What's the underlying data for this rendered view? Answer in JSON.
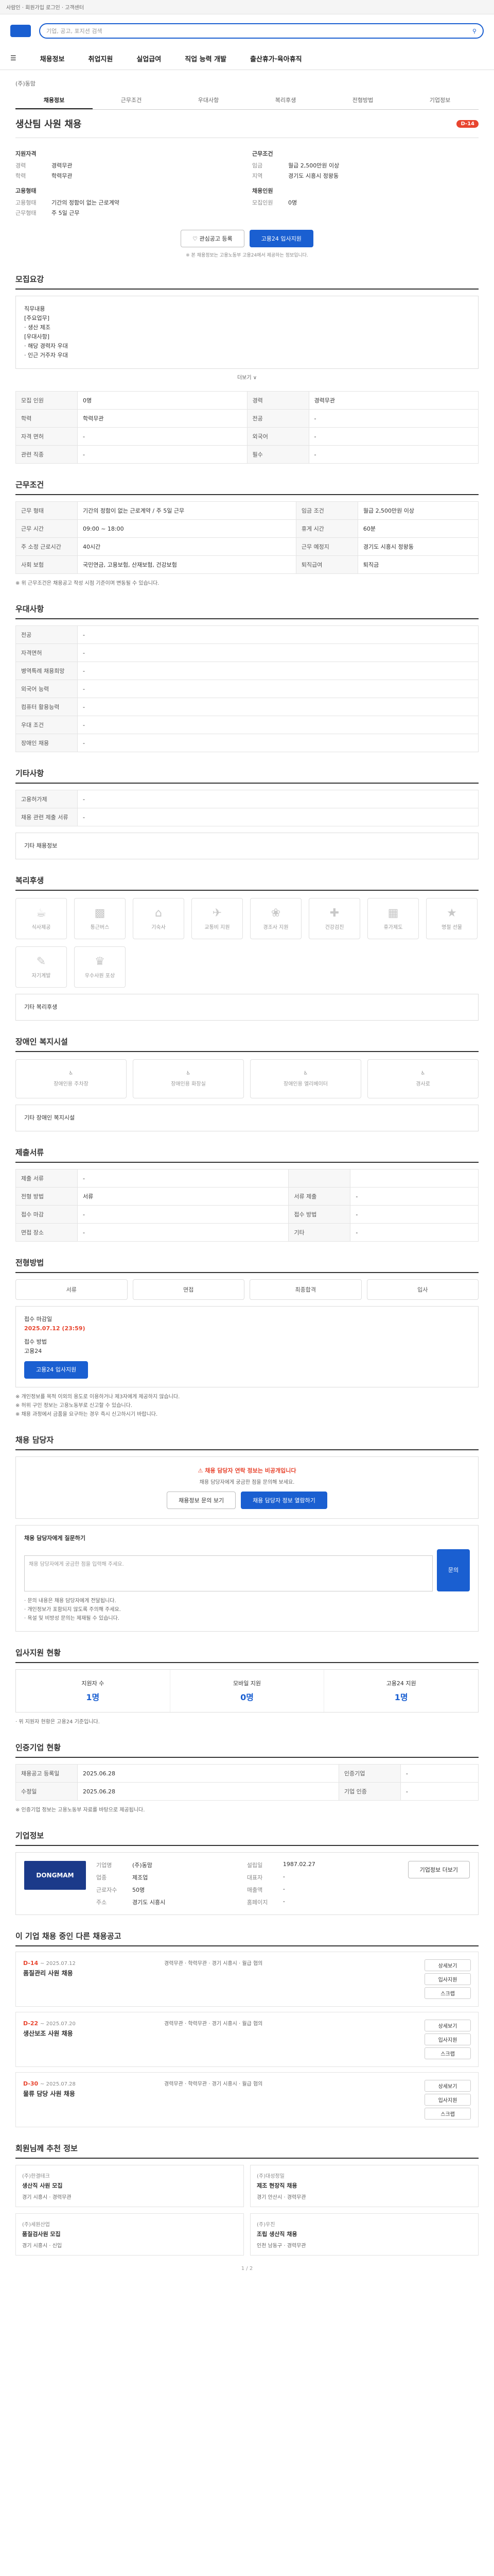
{
  "topbar": {
    "text": "사람인 · 회원가입 로그인 · 고객센터"
  },
  "search": {
    "placeholder": "기업, 공고, 포지션 검색"
  },
  "gnb": [
    "채용정보",
    "취업지원",
    "실업급여",
    "직업 능력 개발",
    "출산휴가·육아휴직"
  ],
  "company_line": "(주)동맘",
  "tabs": [
    "채용정보",
    "근무조건",
    "우대사항",
    "복리후생",
    "전형방법",
    "기업정보"
  ],
  "job": {
    "title": "생산팀 사원 채용",
    "dday": "D-14"
  },
  "summary_left": {
    "h1": "지원자격",
    "rows1": [
      [
        "경력",
        "경력무관"
      ],
      [
        "학력",
        "학력무관"
      ]
    ],
    "h2": "고용형태",
    "rows2": [
      [
        "고용형태",
        "기간의 정함이 없는 근로계약"
      ],
      [
        "근무형태",
        "주 5일 근무"
      ]
    ]
  },
  "summary_right": {
    "h1": "근무조건",
    "rows1": [
      [
        "임금",
        "월급 2,500만원 이상"
      ],
      [
        "지역",
        "경기도 시흥시 정왕동"
      ]
    ],
    "h2": "채용인원",
    "rows2": [
      [
        "모집인원",
        "0명"
      ]
    ]
  },
  "buttons": {
    "scrap": "관심공고 등록",
    "apply": "고용24 입사지원"
  },
  "notice": "※ 본 채용정보는 고용노동부 고용24에서 제공하는 정보입니다.",
  "sections": {
    "s1": "모집요강",
    "s2": "근무조건",
    "s3": "우대사항",
    "s4": "기타사항",
    "s5": "복리후생",
    "s6": "장애인 복지시설",
    "s7": "제출서류",
    "s8": "전형방법",
    "s9": "채용 담당자",
    "s10": "입사지원 현황",
    "s11": "인증기업 현황",
    "s12": "기업정보",
    "s13": "이 기업 채용 중인 다른 채용공고",
    "s14": "회원님께 추천 정보"
  },
  "duty": {
    "lines": [
      "직무내용",
      "[주요업무]",
      "· 생산 제조",
      "[우대사항]",
      "· 해당 경력자 우대",
      "· 인근 거주자 우대"
    ],
    "more": "더보기 ∨"
  },
  "recruit_table": [
    [
      "모집 인원",
      "0명",
      "경력",
      "경력무관"
    ],
    [
      "학력",
      "학력무관",
      "전공",
      "-"
    ],
    [
      "자격 면허",
      "-",
      "외국어",
      "-"
    ],
    [
      "관련 직종",
      "-",
      "필수",
      "-"
    ]
  ],
  "work_table": [
    [
      "근무 형태",
      "기간의 정함이 없는 근로계약 / 주 5일 근무",
      "임금 조건",
      "월급 2,500만원 이상"
    ],
    [
      "근무 시간",
      "09:00 ~ 18:00",
      "휴게 시간",
      "60분"
    ],
    [
      "주 소정 근로시간",
      "40시간",
      "근무 예정지",
      "경기도 시흥시 정왕동"
    ],
    [
      "사회 보험",
      "국민연금, 고용보험, 산재보험, 건강보험",
      "퇴직급여",
      "퇴직금"
    ]
  ],
  "work_note": "※ 위 근무조건은 채용공고 작성 시점 기준이며 변동될 수 있습니다.",
  "pref_table": [
    [
      "전공",
      "-"
    ],
    [
      "자격면허",
      "-"
    ],
    [
      "병역특례 채용희망",
      "-"
    ],
    [
      "외국어 능력",
      "-"
    ],
    [
      "컴퓨터 활용능력",
      "-"
    ],
    [
      "우대 조건",
      "-"
    ],
    [
      "장애인 채용",
      "-"
    ]
  ],
  "etc_table": [
    [
      "고용허가제",
      "-"
    ],
    [
      "채용 관련 제출 서류",
      "-"
    ]
  ],
  "etc_more": "기타 채용정보",
  "welfare_items": [
    "식사제공",
    "통근버스",
    "기숙사",
    "교통비 지원",
    "경조사 지원",
    "건강검진",
    "휴가제도",
    "명절 선물",
    "자기계발",
    "우수사원 포상"
  ],
  "welfare_note": "기타 복리후생",
  "disability_items": [
    "장애인용 주차장",
    "장애인용 화장실",
    "장애인용 엘리베이터",
    "경사로"
  ],
  "disability_note": "기타 장애인 복지시설",
  "docs_table": [
    [
      "제출 서류",
      "-",
      "",
      ""
    ],
    [
      "전형 방법",
      "서류",
      "서류 제출",
      "-"
    ],
    [
      "접수 마감",
      "-",
      "접수 방법",
      "-"
    ],
    [
      "면접 장소",
      "-",
      "기타",
      "-"
    ]
  ],
  "process": [
    "서류",
    "면접",
    "최종합격",
    "입사"
  ],
  "apply": {
    "h": "접수 마감일",
    "date": "2025.07.12 (23:59)",
    "method_h": "접수 방법",
    "method": "고용24",
    "button": "고용24 입사지원"
  },
  "apply_notes": [
    "※ 개인정보를 목적 이외의 용도로 이용하거나 제3자에게 제공하지 않습니다.",
    "※ 허위 구인 정보는 고용노동부로 신고할 수 있습니다.",
    "※ 채용 과정에서 금품을 요구하는 경우 즉시 신고하시기 바랍니다."
  ],
  "qa": {
    "alert": "채용 담당자 연락 정보는 비공개입니다",
    "sub": "채용 담당자에게 궁금한 점을 문의해 보세요.",
    "b1": "채용정보 문의 보기",
    "b2": "채용 담당자 정보 열람하기",
    "h": "채용 담당자에게 질문하기",
    "placeholder": "채용 담당자에게 궁금한 점을 입력해 주세요.",
    "send": "문의"
  },
  "qa_notes": [
    "· 문의 내용은 채용 담당자에게 전달됩니다.",
    "· 개인정보가 포함되지 않도록 주의해 주세요.",
    "· 욕설 및 비방성 문의는 제재될 수 있습니다."
  ],
  "stats": [
    [
      "지원자 수",
      "1명"
    ],
    [
      "모바일 지원",
      "0명"
    ],
    [
      "고용24 지원",
      "1명"
    ]
  ],
  "stats_note": "· 위 지원자 현황은 고용24 기준입니다.",
  "cert_table": [
    [
      "채용공고 등록일",
      "2025.06.28",
      "인증기업",
      "-"
    ],
    [
      "수정일",
      "2025.06.28",
      "기업 인증",
      "-"
    ]
  ],
  "cert_note": "※ 인증기업 정보는 고용노동부 자료를 바탕으로 제공됩니다.",
  "company": {
    "logo": "DONGMAM",
    "rows": [
      [
        "기업명",
        "(주)동맘",
        "설립일",
        "1987.02.27"
      ],
      [
        "업종",
        "제조업",
        "대표자",
        "-"
      ],
      [
        "근로자수",
        "50명",
        "매출액",
        "-"
      ],
      [
        "주소",
        "경기도 시흥시",
        "홈페이지",
        "-"
      ]
    ],
    "btn": "기업정보 더보기"
  },
  "other_jobs": [
    {
      "dd": "D-14",
      "date": "~ 2025.07.12",
      "title": "품질관리 사원 채용",
      "meta": "경력무관 · 학력무관 · 경기 시흥시 · 월급 협의"
    },
    {
      "dd": "D-22",
      "date": "~ 2025.07.20",
      "title": "생산보조 사원 채용",
      "meta": "경력무관 · 학력무관 · 경기 시흥시 · 월급 협의"
    },
    {
      "dd": "D-30",
      "date": "~ 2025.07.28",
      "title": "물류 담당 사원 채용",
      "meta": "경력무관 · 학력무관 · 경기 시흥시 · 월급 협의"
    }
  ],
  "other_btns": [
    "상세보기",
    "입사지원",
    "스크랩"
  ],
  "recs": [
    {
      "c": "(주)한결테크",
      "t": "생산직 사원 모집",
      "m": "경기 시흥시 · 경력무관"
    },
    {
      "c": "(주)대성정밀",
      "t": "제조 현장직 채용",
      "m": "경기 안산시 · 경력무관"
    },
    {
      "c": "(주)세원산업",
      "t": "품질검사원 모집",
      "m": "경기 시흥시 · 신입"
    },
    {
      "c": "(주)우진",
      "t": "조립 생산직 채용",
      "m": "인천 남동구 · 경력무관"
    }
  ],
  "pager": "1 / 2"
}
